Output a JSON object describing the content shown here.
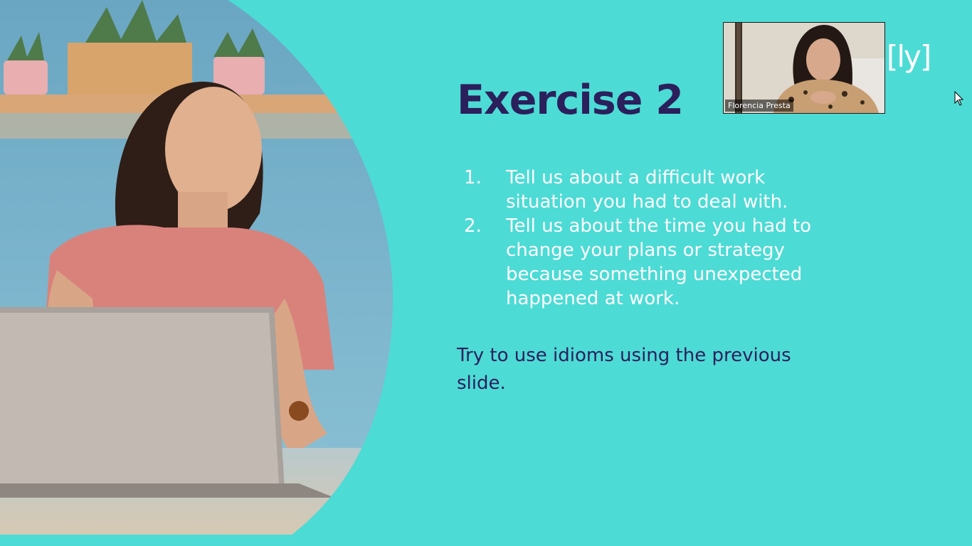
{
  "slide": {
    "title": "Exercise 2",
    "items": [
      {
        "number": "1.",
        "text": "Tell us about a  difficult work situation you had to deal with."
      },
      {
        "number": "2.",
        "text": "Tell us about the time you had to change your plans or strategy because something unexpected happened at work."
      }
    ],
    "note": "Try to use idioms using the previous slide.",
    "logo": "[ly]"
  },
  "video": {
    "participant_name": "Florencia Presta"
  },
  "colors": {
    "background": "#4ddbd5",
    "title": "#2b1f5c",
    "list_text": "#ffffff"
  },
  "icons": {
    "cursor": "mouse-pointer-icon"
  }
}
